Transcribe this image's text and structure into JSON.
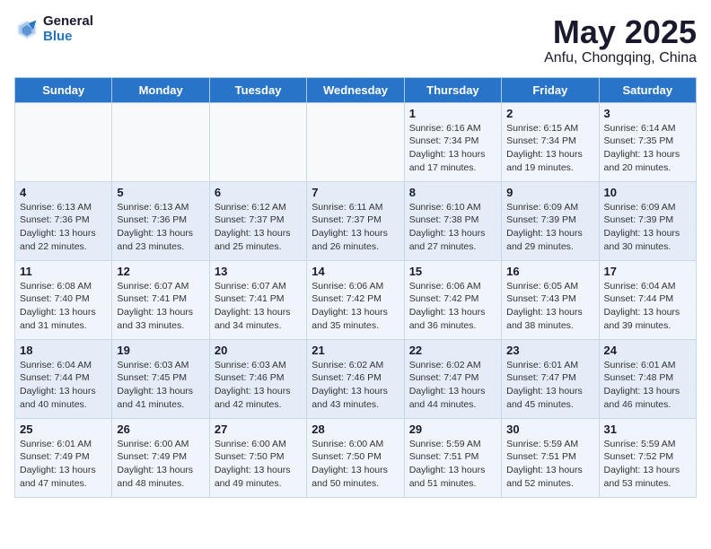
{
  "header": {
    "logo_general": "General",
    "logo_blue": "Blue",
    "title": "May 2025",
    "subtitle": "Anfu, Chongqing, China"
  },
  "days_of_week": [
    "Sunday",
    "Monday",
    "Tuesday",
    "Wednesday",
    "Thursday",
    "Friday",
    "Saturday"
  ],
  "weeks": [
    [
      {
        "day": "",
        "content": ""
      },
      {
        "day": "",
        "content": ""
      },
      {
        "day": "",
        "content": ""
      },
      {
        "day": "",
        "content": ""
      },
      {
        "day": "1",
        "content": "Sunrise: 6:16 AM\nSunset: 7:34 PM\nDaylight: 13 hours\nand 17 minutes."
      },
      {
        "day": "2",
        "content": "Sunrise: 6:15 AM\nSunset: 7:34 PM\nDaylight: 13 hours\nand 19 minutes."
      },
      {
        "day": "3",
        "content": "Sunrise: 6:14 AM\nSunset: 7:35 PM\nDaylight: 13 hours\nand 20 minutes."
      }
    ],
    [
      {
        "day": "4",
        "content": "Sunrise: 6:13 AM\nSunset: 7:36 PM\nDaylight: 13 hours\nand 22 minutes."
      },
      {
        "day": "5",
        "content": "Sunrise: 6:13 AM\nSunset: 7:36 PM\nDaylight: 13 hours\nand 23 minutes."
      },
      {
        "day": "6",
        "content": "Sunrise: 6:12 AM\nSunset: 7:37 PM\nDaylight: 13 hours\nand 25 minutes."
      },
      {
        "day": "7",
        "content": "Sunrise: 6:11 AM\nSunset: 7:37 PM\nDaylight: 13 hours\nand 26 minutes."
      },
      {
        "day": "8",
        "content": "Sunrise: 6:10 AM\nSunset: 7:38 PM\nDaylight: 13 hours\nand 27 minutes."
      },
      {
        "day": "9",
        "content": "Sunrise: 6:09 AM\nSunset: 7:39 PM\nDaylight: 13 hours\nand 29 minutes."
      },
      {
        "day": "10",
        "content": "Sunrise: 6:09 AM\nSunset: 7:39 PM\nDaylight: 13 hours\nand 30 minutes."
      }
    ],
    [
      {
        "day": "11",
        "content": "Sunrise: 6:08 AM\nSunset: 7:40 PM\nDaylight: 13 hours\nand 31 minutes."
      },
      {
        "day": "12",
        "content": "Sunrise: 6:07 AM\nSunset: 7:41 PM\nDaylight: 13 hours\nand 33 minutes."
      },
      {
        "day": "13",
        "content": "Sunrise: 6:07 AM\nSunset: 7:41 PM\nDaylight: 13 hours\nand 34 minutes."
      },
      {
        "day": "14",
        "content": "Sunrise: 6:06 AM\nSunset: 7:42 PM\nDaylight: 13 hours\nand 35 minutes."
      },
      {
        "day": "15",
        "content": "Sunrise: 6:06 AM\nSunset: 7:42 PM\nDaylight: 13 hours\nand 36 minutes."
      },
      {
        "day": "16",
        "content": "Sunrise: 6:05 AM\nSunset: 7:43 PM\nDaylight: 13 hours\nand 38 minutes."
      },
      {
        "day": "17",
        "content": "Sunrise: 6:04 AM\nSunset: 7:44 PM\nDaylight: 13 hours\nand 39 minutes."
      }
    ],
    [
      {
        "day": "18",
        "content": "Sunrise: 6:04 AM\nSunset: 7:44 PM\nDaylight: 13 hours\nand 40 minutes."
      },
      {
        "day": "19",
        "content": "Sunrise: 6:03 AM\nSunset: 7:45 PM\nDaylight: 13 hours\nand 41 minutes."
      },
      {
        "day": "20",
        "content": "Sunrise: 6:03 AM\nSunset: 7:46 PM\nDaylight: 13 hours\nand 42 minutes."
      },
      {
        "day": "21",
        "content": "Sunrise: 6:02 AM\nSunset: 7:46 PM\nDaylight: 13 hours\nand 43 minutes."
      },
      {
        "day": "22",
        "content": "Sunrise: 6:02 AM\nSunset: 7:47 PM\nDaylight: 13 hours\nand 44 minutes."
      },
      {
        "day": "23",
        "content": "Sunrise: 6:01 AM\nSunset: 7:47 PM\nDaylight: 13 hours\nand 45 minutes."
      },
      {
        "day": "24",
        "content": "Sunrise: 6:01 AM\nSunset: 7:48 PM\nDaylight: 13 hours\nand 46 minutes."
      }
    ],
    [
      {
        "day": "25",
        "content": "Sunrise: 6:01 AM\nSunset: 7:49 PM\nDaylight: 13 hours\nand 47 minutes."
      },
      {
        "day": "26",
        "content": "Sunrise: 6:00 AM\nSunset: 7:49 PM\nDaylight: 13 hours\nand 48 minutes."
      },
      {
        "day": "27",
        "content": "Sunrise: 6:00 AM\nSunset: 7:50 PM\nDaylight: 13 hours\nand 49 minutes."
      },
      {
        "day": "28",
        "content": "Sunrise: 6:00 AM\nSunset: 7:50 PM\nDaylight: 13 hours\nand 50 minutes."
      },
      {
        "day": "29",
        "content": "Sunrise: 5:59 AM\nSunset: 7:51 PM\nDaylight: 13 hours\nand 51 minutes."
      },
      {
        "day": "30",
        "content": "Sunrise: 5:59 AM\nSunset: 7:51 PM\nDaylight: 13 hours\nand 52 minutes."
      },
      {
        "day": "31",
        "content": "Sunrise: 5:59 AM\nSunset: 7:52 PM\nDaylight: 13 hours\nand 53 minutes."
      }
    ]
  ]
}
